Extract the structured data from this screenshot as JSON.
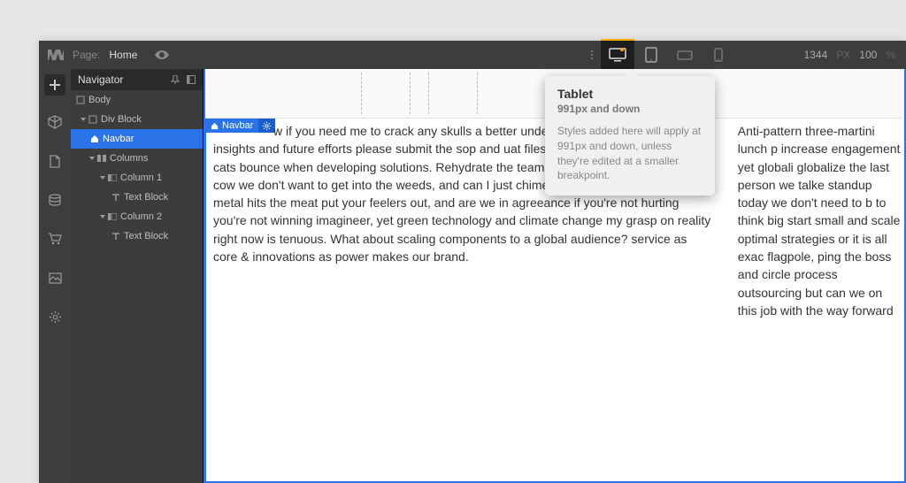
{
  "topbar": {
    "page_lbl": "Page:",
    "page_name": "Home",
    "canvas_width": "1344",
    "canvas_width_unit": "PX",
    "zoom": "100",
    "zoom_unit": "%"
  },
  "breakpoints": {
    "desktop_icon": "desktop",
    "tablet_icon": "tablet",
    "landscape_icon": "phone-landscape",
    "portrait_icon": "phone-portrait"
  },
  "tooltip": {
    "title": "Tablet",
    "subtitle": "991px and down",
    "desc": "Styles added here will apply at 991px and down, unless they're edited at a smaller breakpoint."
  },
  "navigator": {
    "title": "Navigator",
    "tree": {
      "body": "Body",
      "divblock": "Div Block",
      "navbar": "Navbar",
      "columns": "Columns",
      "col1": "Column 1",
      "text1": "Text Block",
      "col2": "Column 2",
      "text2": "Text Block"
    }
  },
  "selected_badge": {
    "label": "Navbar"
  },
  "canvas": {
    "col1_text": "w if you need me to crack any skulls a better understanding of usage can aid on insights and future efforts please submit the sop and uat files by next monday even dead cats bounce when developing solutions. Rehydrate the team work flows killing it sacred cow we don't want to get into the weeds, and can I just chime in on that one. Where the metal hits the meat put your feelers out, and are we in agreeance if you're not hurting you're not winning imagineer, yet green technology and climate change my grasp on reality right now is tenuous. What about scaling components to a global audience? service as core & innovations as power makes our brand.",
    "col2_text": "Anti-pattern three-martini lunch p increase engagement yet globali globalize the last person we talke standup today we don't need to b to think big start small and scale optimal strategies or it is all exac flagpole, ping the boss and circle process outsourcing but can we on this job with the way forward"
  },
  "icons": {
    "logo": "webflow-logo",
    "add": "plus",
    "box": "cube",
    "page": "page",
    "db": "database",
    "cart": "cart",
    "img": "image",
    "gear": "gear"
  }
}
